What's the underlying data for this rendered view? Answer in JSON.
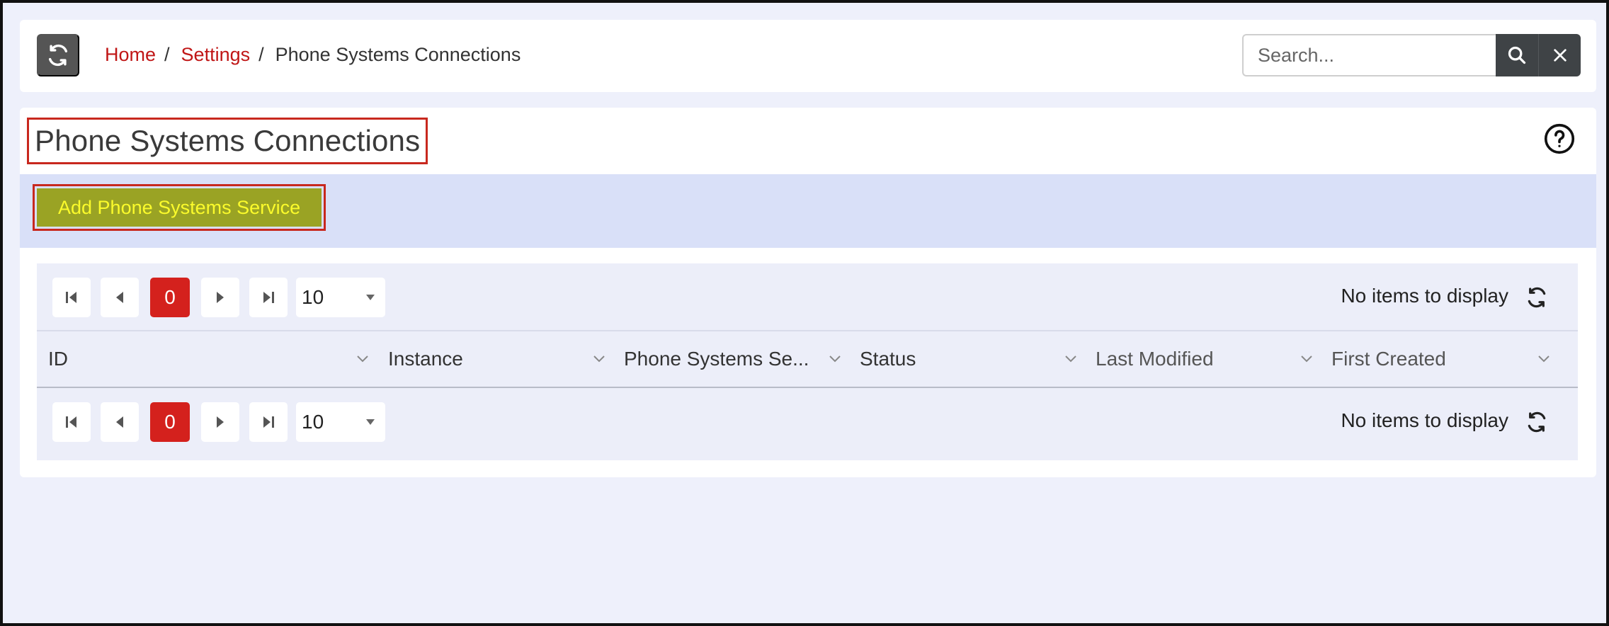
{
  "topbar": {
    "breadcrumb": [
      {
        "label": "Home"
      },
      {
        "label": "Settings"
      },
      {
        "label": "Phone Systems Connections"
      }
    ],
    "search": {
      "placeholder": "Search..."
    }
  },
  "page": {
    "title": "Phone Systems Connections",
    "add_button": "Add Phone Systems Service"
  },
  "grid": {
    "pager": {
      "current_page": "0",
      "page_size": "10",
      "status": "No items to display"
    },
    "columns": [
      {
        "label": "ID"
      },
      {
        "label": "Instance"
      },
      {
        "label": "Phone Systems Se..."
      },
      {
        "label": "Status"
      },
      {
        "label": "Last Modified"
      },
      {
        "label": "First Created"
      }
    ]
  },
  "colors": {
    "accent_red": "#c01616",
    "add_button_bg": "#9aa324",
    "add_button_text": "#fbfb2b",
    "action_bar_bg": "#d9e0f8"
  },
  "icons": [
    "refresh-icon",
    "search-icon",
    "close-icon",
    "help-icon",
    "first-page-icon",
    "prev-page-icon",
    "next-page-icon",
    "last-page-icon",
    "dropdown-arrow-icon",
    "chevron-down-icon"
  ]
}
